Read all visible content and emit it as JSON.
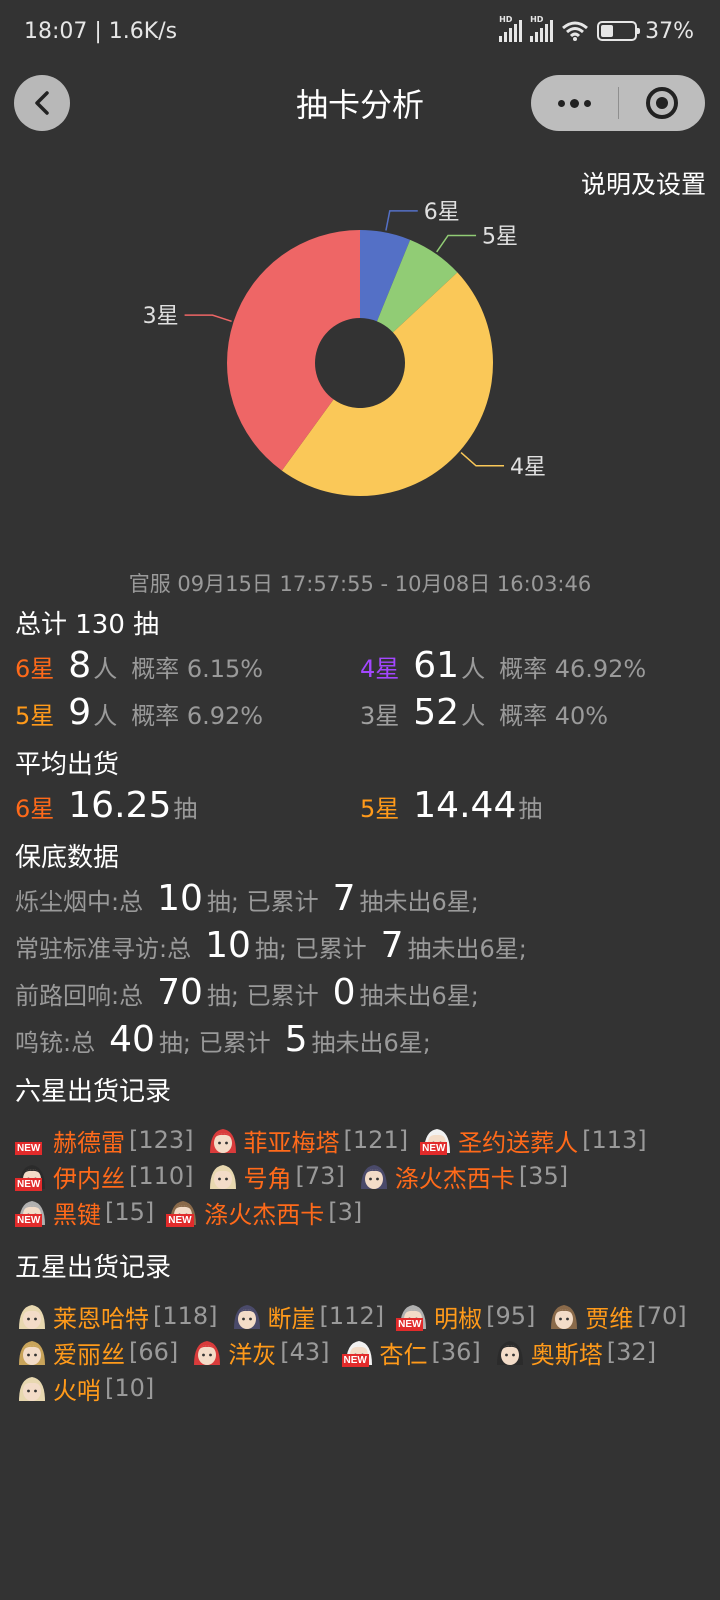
{
  "status": {
    "time_speed": "18:07 | 1.6K/s",
    "battery": "37%",
    "battery_level": 0.37
  },
  "header": {
    "title": "抽卡分析"
  },
  "settings_link": "说明及设置",
  "chart_data": {
    "type": "pie",
    "donut": true,
    "categories": [
      "6星",
      "5星",
      "4星",
      "3星"
    ],
    "values": [
      8,
      9,
      61,
      52
    ],
    "colors": [
      "#5470c6",
      "#91cc75",
      "#fac858",
      "#ee6666"
    ]
  },
  "date_range": "官服  09月15日 17:57:55  -  10月08日 16:03:46",
  "summary": {
    "title": "总计 130 抽",
    "rows": [
      {
        "star": "6星",
        "count": "8",
        "unit": "人",
        "rate": "概率 6.15%"
      },
      {
        "star": "4星",
        "count": "61",
        "unit": "人",
        "rate": "概率 46.92%"
      },
      {
        "star": "5星",
        "count": "9",
        "unit": "人",
        "rate": "概率 6.92%"
      },
      {
        "star": "3星",
        "count": "52",
        "unit": "人",
        "rate": "概率 40%"
      }
    ]
  },
  "average": {
    "title": "平均出货",
    "rows": [
      {
        "star": "6星",
        "value": "16.25",
        "unit": "抽"
      },
      {
        "star": "5星",
        "value": "14.44",
        "unit": "抽"
      }
    ]
  },
  "pity": {
    "title": "保底数据",
    "rows": [
      {
        "pool": "烁尘烟中:总",
        "total": "10",
        "mid": "抽;  已累计",
        "acc": "7",
        "tail": "抽未出6星;"
      },
      {
        "pool": "常驻标准寻访:总",
        "total": "10",
        "mid": "抽;  已累计",
        "acc": "7",
        "tail": "抽未出6星;"
      },
      {
        "pool": "前路回响:总",
        "total": "70",
        "mid": "抽;  已累计",
        "acc": "0",
        "tail": "抽未出6星;"
      },
      {
        "pool": "鸣铳:总",
        "total": "40",
        "mid": "抽;  已累计",
        "acc": "5",
        "tail": "抽未出6星;"
      }
    ]
  },
  "six_star": {
    "title": "六星出货记录",
    "new_label": "NEW",
    "lines": [
      [
        {
          "name": "赫德雷",
          "count": "[123]",
          "new": true,
          "avatar": false
        },
        {
          "name": "菲亚梅塔",
          "count": "[121]",
          "new": false,
          "avatar": true
        },
        {
          "name": "圣约送葬人",
          "count": "[113]",
          "new": true,
          "avatar": true
        }
      ],
      [
        {
          "name": "伊内丝",
          "count": "[110]",
          "new": true,
          "avatar": true
        },
        {
          "name": "号角",
          "count": "[73]",
          "new": false,
          "avatar": true
        },
        {
          "name": "涤火杰西卡",
          "count": "[35]",
          "new": false,
          "avatar": true
        }
      ],
      [
        {
          "name": "黑键",
          "count": "[15]",
          "new": true,
          "avatar": true
        },
        {
          "name": "涤火杰西卡",
          "count": "[3]",
          "new": true,
          "avatar": true
        }
      ]
    ]
  },
  "five_star": {
    "title": "五星出货记录",
    "new_label": "NEW",
    "lines": [
      [
        {
          "name": "莱恩哈特",
          "count": "[118]",
          "new": false,
          "avatar": true
        },
        {
          "name": "断崖",
          "count": "[112]",
          "new": false,
          "avatar": true
        },
        {
          "name": "明椒",
          "count": "[95]",
          "new": true,
          "avatar": true
        },
        {
          "name": "贾维",
          "count": "[70]",
          "new": false,
          "avatar": true
        }
      ],
      [
        {
          "name": "爱丽丝",
          "count": "[66]",
          "new": false,
          "avatar": true
        },
        {
          "name": "洋灰",
          "count": "[43]",
          "new": false,
          "avatar": true
        },
        {
          "name": "杏仁",
          "count": "[36]",
          "new": true,
          "avatar": true
        },
        {
          "name": "奥斯塔",
          "count": "[32]",
          "new": false,
          "avatar": true
        }
      ],
      [
        {
          "name": "火哨",
          "count": "[10]",
          "new": false,
          "avatar": true
        }
      ]
    ]
  }
}
